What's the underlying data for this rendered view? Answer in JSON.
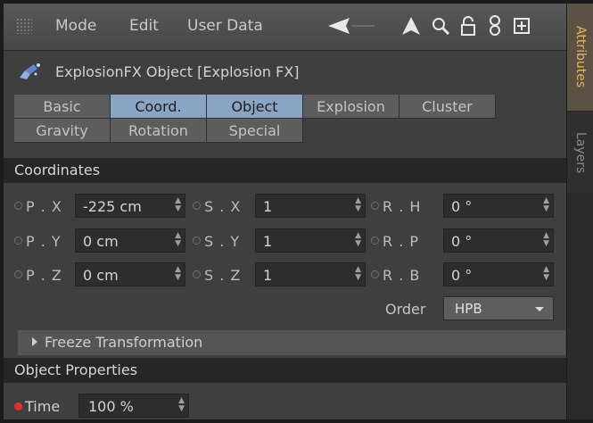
{
  "menu": {
    "items": [
      "Mode",
      "Edit",
      "User Data"
    ]
  },
  "toolbar": {
    "icons": [
      "back-arrow-icon",
      "up-arrow-icon",
      "search-icon",
      "lock-icon",
      "link-icon",
      "new-panel-icon"
    ]
  },
  "object": {
    "title": "ExplosionFX Object [Explosion FX]",
    "icon": "explosion-object-icon"
  },
  "tabs": [
    {
      "label": "Basic",
      "active": false
    },
    {
      "label": "Coord.",
      "active": true
    },
    {
      "label": "Object",
      "active": true
    },
    {
      "label": "Explosion",
      "active": false
    },
    {
      "label": "Cluster",
      "active": false
    },
    {
      "label": "Gravity",
      "active": false
    },
    {
      "label": "Rotation",
      "active": false
    },
    {
      "label": "Special",
      "active": false
    }
  ],
  "coordinates": {
    "header": "Coordinates",
    "rows": [
      {
        "p_label": "P . X",
        "p_value": "-225 cm",
        "s_label": "S . X",
        "s_value": "1",
        "r_label": "R . H",
        "r_value": "0 °"
      },
      {
        "p_label": "P . Y",
        "p_value": "0 cm",
        "s_label": "S . Y",
        "s_value": "1",
        "r_label": "R . P",
        "r_value": "0 °"
      },
      {
        "p_label": "P . Z",
        "p_value": "0 cm",
        "s_label": "S . Z",
        "s_value": "1",
        "r_label": "R . B",
        "r_value": "0 °"
      }
    ],
    "order_label": "Order",
    "order_value": "HPB",
    "freeze": "Freeze Transformation"
  },
  "object_properties": {
    "header": "Object Properties",
    "time_label": "Time",
    "time_value": "100 %"
  },
  "sidetabs": {
    "attributes": "Attributes",
    "layers": "Layers"
  },
  "colors": {
    "active_tab": "#8aa4c4",
    "accent_tab": "#e6b45a",
    "keyframe_dot": "#e03030"
  }
}
